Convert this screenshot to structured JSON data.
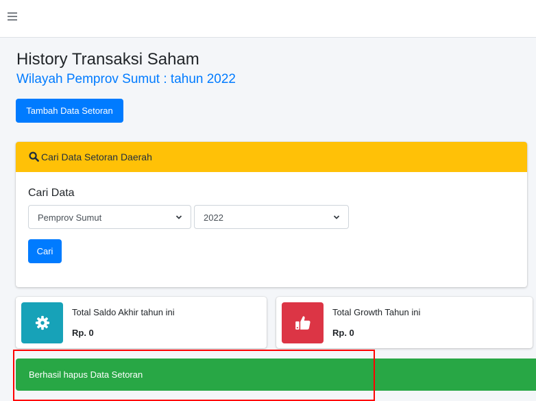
{
  "header": {
    "menu_icon": "hamburger-menu-icon"
  },
  "page": {
    "title": "History Transaksi Saham",
    "subtitle": "Wilayah Pemprov Sumut : tahun 2022"
  },
  "actions": {
    "add_label": "Tambah Data Setoran"
  },
  "search": {
    "header_icon": "search-icon",
    "header_label": "Cari Data Setoran Daerah",
    "field_label": "Cari Data",
    "wilayah_value": "Pemprov Sumut",
    "tahun_value": "2022",
    "submit_label": "Cari"
  },
  "stats": [
    {
      "icon": "gear-icon",
      "label": "Total Saldo Akhir tahun ini",
      "value": "Rp. 0",
      "color": "#17a2b8"
    },
    {
      "icon": "thumbs-up-icon",
      "label": "Total Growth Tahun ini",
      "value": "Rp. 0",
      "color": "#dc3545"
    }
  ],
  "alert": {
    "message": "Berhasil hapus Data Setoran",
    "color": "#28a745",
    "highlight_color": "#ff0000"
  },
  "colors": {
    "primary": "#007bff",
    "warning": "#ffc107",
    "background": "#f4f6f9"
  }
}
